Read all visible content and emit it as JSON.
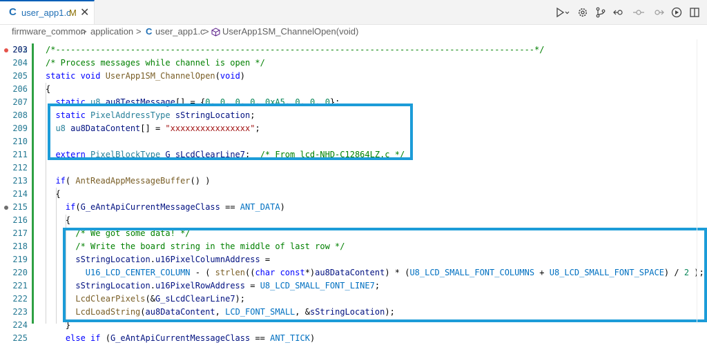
{
  "tab": {
    "lang_badge": "C",
    "filename": "user_app1.c",
    "modified_flag": "M",
    "close_glyph": "✕"
  },
  "toolbar": {
    "icons": [
      "run-debug-icon",
      "chevron-down-icon",
      "settings-icon",
      "source-control-icon",
      "go-back-icon",
      "go-forward-history-icon",
      "go-forward-icon",
      "debug-icon",
      "split-editor-icon"
    ]
  },
  "breadcrumb": {
    "items": [
      "firmware_common",
      "application",
      "user_app1.c",
      "UserApp1SM_ChannelOpen(void)"
    ],
    "separator": ">"
  },
  "editor": {
    "partial_top_line_number": "202",
    "lines": [
      {
        "n": "203",
        "marker": "red",
        "tokens": [
          [
            "c",
            "  /*------------------------------------------------------------------------------------------------*/"
          ]
        ]
      },
      {
        "n": "204",
        "tokens": [
          [
            "c",
            "  /* Process messages while channel is open */"
          ]
        ]
      },
      {
        "n": "205",
        "tokens": [
          [
            "k",
            "  static void "
          ],
          [
            "f",
            "UserApp1SM_ChannelOpen"
          ],
          [
            "p",
            "("
          ],
          [
            "k",
            "void"
          ],
          [
            "p",
            ")"
          ]
        ]
      },
      {
        "n": "206",
        "tokens": [
          [
            "p",
            "  {"
          ]
        ]
      },
      {
        "n": "207",
        "tokens": [
          [
            "k",
            "    static "
          ],
          [
            "t",
            "u8 "
          ],
          [
            "v",
            "au8TestMessage"
          ],
          [
            "p",
            "[] = {"
          ],
          [
            "n",
            "0"
          ],
          [
            "p",
            ", "
          ],
          [
            "n",
            "0"
          ],
          [
            "p",
            ", "
          ],
          [
            "n",
            "0"
          ],
          [
            "p",
            ", "
          ],
          [
            "n",
            "0"
          ],
          [
            "p",
            ", "
          ],
          [
            "n",
            "0xA5"
          ],
          [
            "p",
            ", "
          ],
          [
            "n",
            "0"
          ],
          [
            "p",
            ", "
          ],
          [
            "n",
            "0"
          ],
          [
            "p",
            ", "
          ],
          [
            "n",
            "0"
          ],
          [
            "p",
            "};"
          ]
        ]
      },
      {
        "n": "208",
        "tokens": [
          [
            "k",
            "    static "
          ],
          [
            "t",
            "PixelAddressType "
          ],
          [
            "v",
            "sStringLocation"
          ],
          [
            "p",
            ";"
          ]
        ]
      },
      {
        "n": "209",
        "tokens": [
          [
            "t",
            "    u8 "
          ],
          [
            "v",
            "au8DataContent"
          ],
          [
            "p",
            "[] = "
          ],
          [
            "s",
            "\"xxxxxxxxxxxxxxxx\""
          ],
          [
            "p",
            ";"
          ]
        ]
      },
      {
        "n": "210",
        "tokens": [
          [
            "p",
            ""
          ]
        ]
      },
      {
        "n": "211",
        "tokens": [
          [
            "k",
            "    extern "
          ],
          [
            "t",
            "PixelBlockType "
          ],
          [
            "v",
            "G_sLcdClearLine7"
          ],
          [
            "p",
            ";  "
          ],
          [
            "c",
            "/* From lcd-NHD-C12864LZ.c */"
          ]
        ]
      },
      {
        "n": "212",
        "tokens": [
          [
            "p",
            ""
          ]
        ]
      },
      {
        "n": "213",
        "tokens": [
          [
            "k",
            "    if"
          ],
          [
            "p",
            "( "
          ],
          [
            "f",
            "AntReadAppMessageBuffer"
          ],
          [
            "p",
            "() )"
          ]
        ]
      },
      {
        "n": "214",
        "tokens": [
          [
            "p",
            "    {"
          ]
        ]
      },
      {
        "n": "215",
        "marker": "gray",
        "tokens": [
          [
            "k",
            "      if"
          ],
          [
            "p",
            "("
          ],
          [
            "v",
            "G_eAntApiCurrentMessageClass"
          ],
          [
            "p",
            " == "
          ],
          [
            "m",
            "ANT_DATA"
          ],
          [
            "p",
            ")"
          ]
        ]
      },
      {
        "n": "216",
        "tokens": [
          [
            "p",
            "      {"
          ]
        ]
      },
      {
        "n": "217",
        "tokens": [
          [
            "c",
            "        /* We got some data! */"
          ]
        ]
      },
      {
        "n": "218",
        "tokens": [
          [
            "c",
            "        /* Write the board string in the middle of last row */"
          ]
        ]
      },
      {
        "n": "219",
        "tokens": [
          [
            "v",
            "        sStringLocation"
          ],
          [
            "p",
            "."
          ],
          [
            "v",
            "u16PixelColumnAddress"
          ],
          [
            "p",
            " ="
          ]
        ]
      },
      {
        "n": "220",
        "tokens": [
          [
            "m",
            "          U16_LCD_CENTER_COLUMN"
          ],
          [
            "p",
            " - ( "
          ],
          [
            "f",
            "strlen"
          ],
          [
            "p",
            "(("
          ],
          [
            "k",
            "char const"
          ],
          [
            "p",
            "*)"
          ],
          [
            "v",
            "au8DataContent"
          ],
          [
            "p",
            ") * ("
          ],
          [
            "m",
            "U8_LCD_SMALL_FONT_COLUMNS"
          ],
          [
            "p",
            " + "
          ],
          [
            "m",
            "U8_LCD_SMALL_FONT_SPACE"
          ],
          [
            "p",
            ") / "
          ],
          [
            "n",
            "2"
          ],
          [
            "p",
            " );"
          ]
        ]
      },
      {
        "n": "221",
        "tokens": [
          [
            "v",
            "        sStringLocation"
          ],
          [
            "p",
            "."
          ],
          [
            "v",
            "u16PixelRowAddress"
          ],
          [
            "p",
            " = "
          ],
          [
            "m",
            "U8_LCD_SMALL_FONT_LINE7"
          ],
          [
            "p",
            ";"
          ]
        ]
      },
      {
        "n": "222",
        "tokens": [
          [
            "f",
            "        LcdClearPixels"
          ],
          [
            "p",
            "(&"
          ],
          [
            "v",
            "G_sLcdClearLine7"
          ],
          [
            "p",
            ");"
          ]
        ]
      },
      {
        "n": "223",
        "tokens": [
          [
            "f",
            "        LcdLoadString"
          ],
          [
            "p",
            "("
          ],
          [
            "v",
            "au8DataContent"
          ],
          [
            "p",
            ", "
          ],
          [
            "m",
            "LCD_FONT_SMALL"
          ],
          [
            "p",
            ", &"
          ],
          [
            "v",
            "sStringLocation"
          ],
          [
            "p",
            ");"
          ]
        ]
      },
      {
        "n": "224",
        "tokens": [
          [
            "p",
            "      }"
          ]
        ]
      },
      {
        "n": "225",
        "tokens": [
          [
            "k",
            "      else if"
          ],
          [
            "p",
            " ("
          ],
          [
            "v",
            "G_eAntApiCurrentMessageClass"
          ],
          [
            "p",
            " == "
          ],
          [
            "m",
            "ANT_TICK"
          ],
          [
            "p",
            ")"
          ]
        ]
      }
    ]
  },
  "colors": {
    "highlight_box": "#1c9cd8",
    "modified_gutter": "#2ea043",
    "tab_accent": "#005fb8"
  }
}
